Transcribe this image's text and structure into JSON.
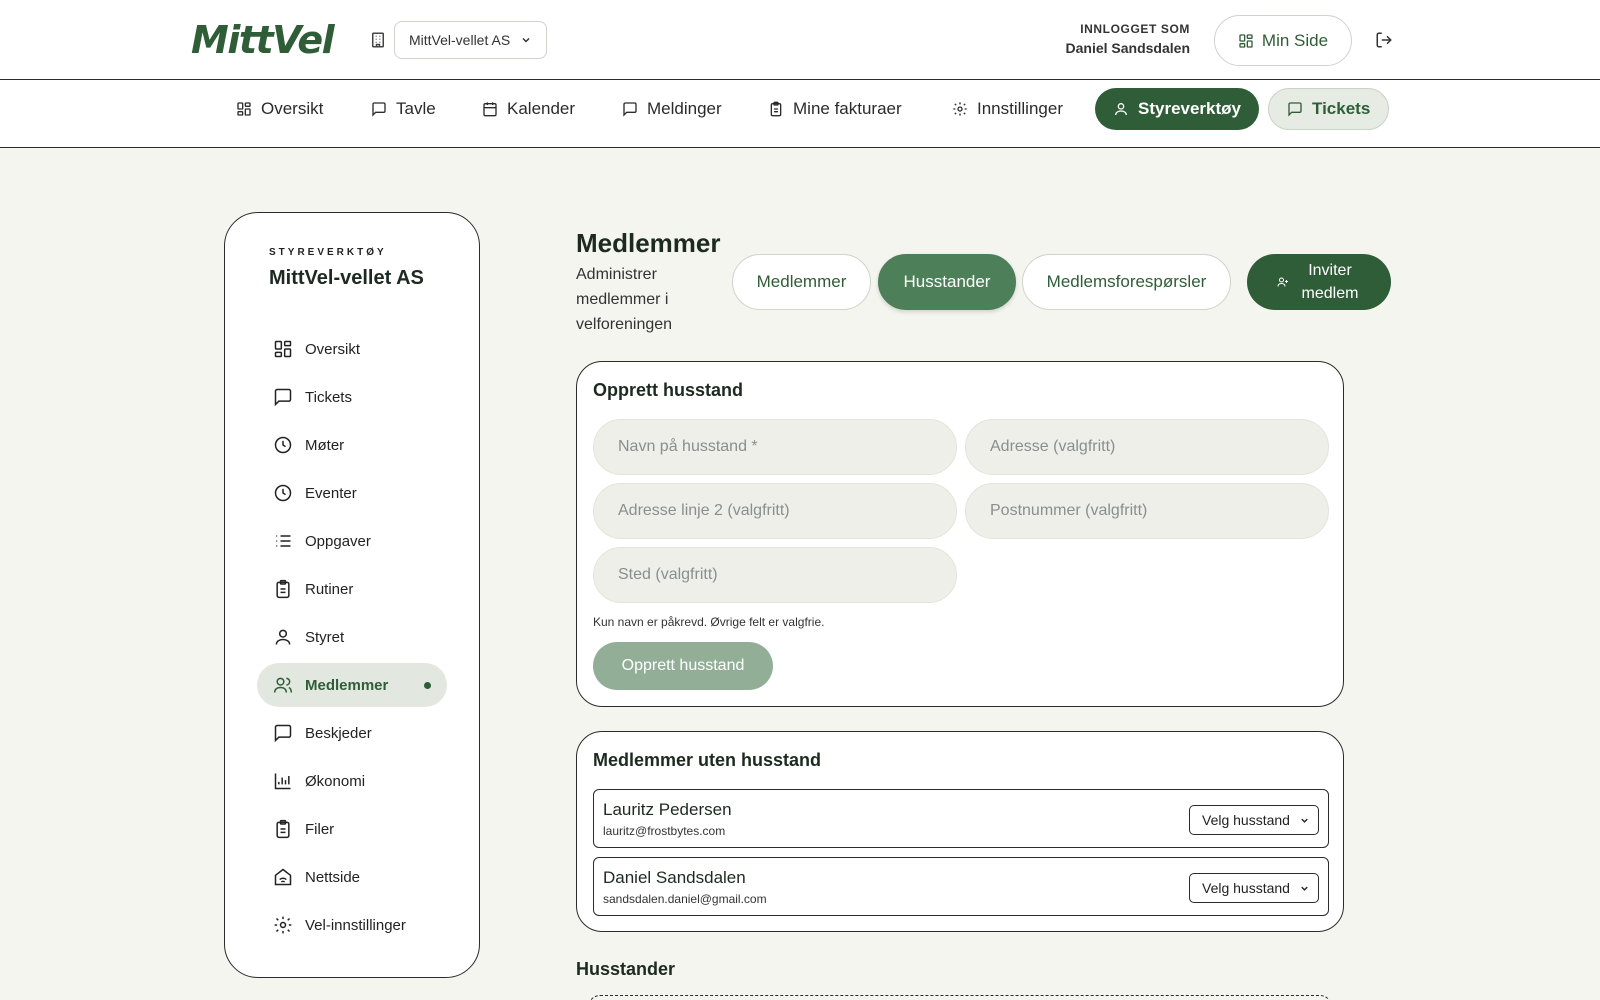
{
  "header": {
    "logo": "MittVel",
    "org_select": "MittVel-vellet AS",
    "login_label": "INNLOGGET SOM",
    "login_name": "Daniel Sandsdalen",
    "min_side": "Min Side"
  },
  "nav": {
    "items": [
      {
        "label": "Oversikt",
        "icon": "grid-icon"
      },
      {
        "label": "Tavle",
        "icon": "chat-icon"
      },
      {
        "label": "Kalender",
        "icon": "calendar-icon"
      },
      {
        "label": "Meldinger",
        "icon": "chat-icon"
      },
      {
        "label": "Mine fakturaer",
        "icon": "clipboard-icon"
      },
      {
        "label": "Innstillinger",
        "icon": "gear-icon"
      },
      {
        "label": "Styreverktøy",
        "icon": "user-icon"
      },
      {
        "label": "Tickets",
        "icon": "chat-icon"
      }
    ]
  },
  "sidebar": {
    "eyebrow": "STYREVERKTØY",
    "title": "MittVel-vellet AS",
    "items": [
      {
        "label": "Oversikt",
        "icon": "grid-icon"
      },
      {
        "label": "Tickets",
        "icon": "chat-icon"
      },
      {
        "label": "Møter",
        "icon": "clock-icon"
      },
      {
        "label": "Eventer",
        "icon": "clock-icon"
      },
      {
        "label": "Oppgaver",
        "icon": "list-icon"
      },
      {
        "label": "Rutiner",
        "icon": "clipboard-icon"
      },
      {
        "label": "Styret",
        "icon": "user-icon"
      },
      {
        "label": "Medlemmer",
        "icon": "users-icon"
      },
      {
        "label": "Beskjeder",
        "icon": "chat-icon"
      },
      {
        "label": "Økonomi",
        "icon": "bar-chart-icon"
      },
      {
        "label": "Filer",
        "icon": "clipboard-icon"
      },
      {
        "label": "Nettside",
        "icon": "home-wifi-icon"
      },
      {
        "label": "Vel-innstillinger",
        "icon": "gear-icon"
      }
    ]
  },
  "main": {
    "title": "Medlemmer",
    "subtitle": "Administrer medlemmer i velforeningen",
    "tabs": [
      "Medlemmer",
      "Husstander",
      "Medlemsforespørsler"
    ],
    "invite_label": "Inviter medlem",
    "create_card": {
      "title": "Opprett husstand",
      "fields": {
        "name": "Navn på husstand *",
        "address": "Adresse (valgfritt)",
        "address2": "Adresse linje 2 (valgfritt)",
        "zip": "Postnummer (valgfritt)",
        "city": "Sted (valgfritt)"
      },
      "hint": "Kun navn er påkrevd. Øvrige felt er valgfrie.",
      "submit": "Opprett husstand"
    },
    "unassigned": {
      "title": "Medlemmer uten husstand",
      "members": [
        {
          "name": "Lauritz Pedersen",
          "email": "lauritz@frostbytes.com",
          "select": "Velg husstand"
        },
        {
          "name": "Daniel Sandsdalen",
          "email": "sandsdalen.daniel@gmail.com",
          "select": "Velg husstand"
        }
      ]
    },
    "households_title": "Husstander"
  },
  "colors": {
    "brand": "#2f5d38",
    "brand_mid": "#4d7f58",
    "brand_soft": "#92ae97",
    "background": "#f4f5ef"
  }
}
